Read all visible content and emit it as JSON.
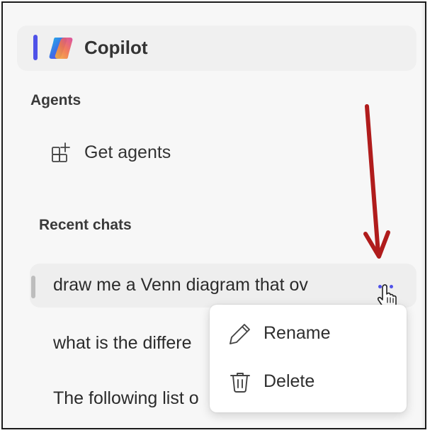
{
  "header": {
    "app_name": "Copilot"
  },
  "agents": {
    "heading": "Agents",
    "get_agents_label": "Get agents"
  },
  "recent": {
    "heading": "Recent chats",
    "chats": [
      "draw me a Venn diagram that ov",
      "what is the differe",
      "The following list o"
    ]
  },
  "context_menu": {
    "items": [
      "Rename",
      "Delete"
    ]
  },
  "colors": {
    "accent": "#4f52e8",
    "annotation_arrow": "#b01c1c"
  },
  "icons": {
    "logo": "copilot-logo",
    "get_agents": "apps-add-icon",
    "more": "more-horizontal-icon",
    "rename": "pencil-icon",
    "delete": "trash-icon"
  }
}
